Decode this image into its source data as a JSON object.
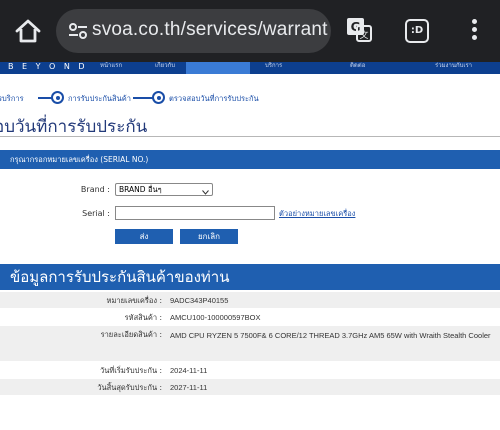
{
  "browser": {
    "url": "svoa.co.th/services/warrant",
    "tabs_count": ":D"
  },
  "site_nav": {
    "logo": "B E Y O N D",
    "items": [
      "หน้าแรก",
      "เกี่ยวกับ",
      "บริการ",
      "ติดต่อ",
      "ร่วมงานกับเรา"
    ]
  },
  "breadcrumb": {
    "items": [
      "รบริการ",
      "การรับประกันสินค้า",
      "ตรวจสอบวันที่การรับประกัน"
    ]
  },
  "page_title": "อบวันที่การรับประกัน",
  "serial_form": {
    "header": "กรุณากรอกหมายเลขเครื่อง (SERIAL NO.)",
    "brand_label": "Brand :",
    "brand_value": "BRAND อื่นๆ",
    "serial_label": "Serial :",
    "serial_value": "",
    "serial_example": "ตัวอย่างหมายเลขเครื่อง",
    "submit_label": "ส่ง",
    "cancel_label": "ยกเลิก"
  },
  "warranty_info": {
    "header": "ข้อมูลการรับประกันสินค้าของท่าน",
    "rows": [
      {
        "key": "หมายเลขเครื่อง :",
        "value": "9ADC343P40155"
      },
      {
        "key": "รหัสสินค้า :",
        "value": "AMCU100-100000597BOX"
      },
      {
        "key": "รายละเอียดสินค้า :",
        "value": "AMD CPU RYZEN 5 7500F& 6 CORE/12 THREAD 3.7GHz AM5 65W with Wraith Stealth Cooler"
      },
      {
        "key": "วันที่เริ่มรับประกัน :",
        "value": "2024-11-11"
      },
      {
        "key": "วันสิ้นสุดรับประกัน :",
        "value": "2027-11-11"
      }
    ]
  },
  "colors": {
    "brand_blue": "#1f5fb0",
    "link_blue": "#1a4ea8",
    "chrome_bg": "#202124"
  }
}
